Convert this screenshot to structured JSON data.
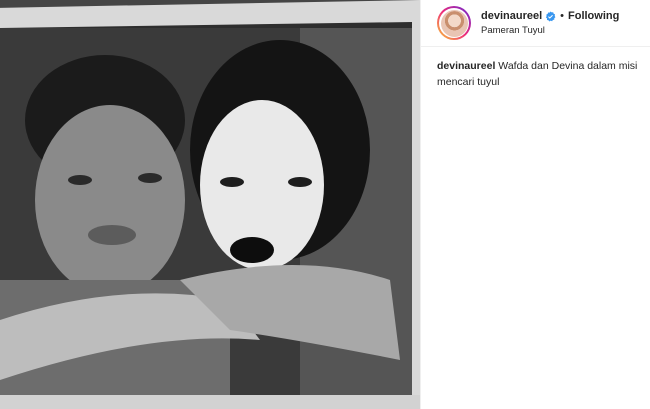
{
  "post": {
    "username": "devinaureel",
    "follow_label": "Following",
    "dot": "•",
    "location": "Pameran Tuyul",
    "caption": {
      "username": "devinaureel",
      "text": "Wafda dan Devina dalam misi mencari tuyul"
    }
  },
  "icons": {
    "verified": "verified-badge-icon",
    "avatar": "profile-avatar"
  },
  "colors": {
    "verified_blue": "#3897f0",
    "text": "#262626",
    "border": "#efefef"
  }
}
